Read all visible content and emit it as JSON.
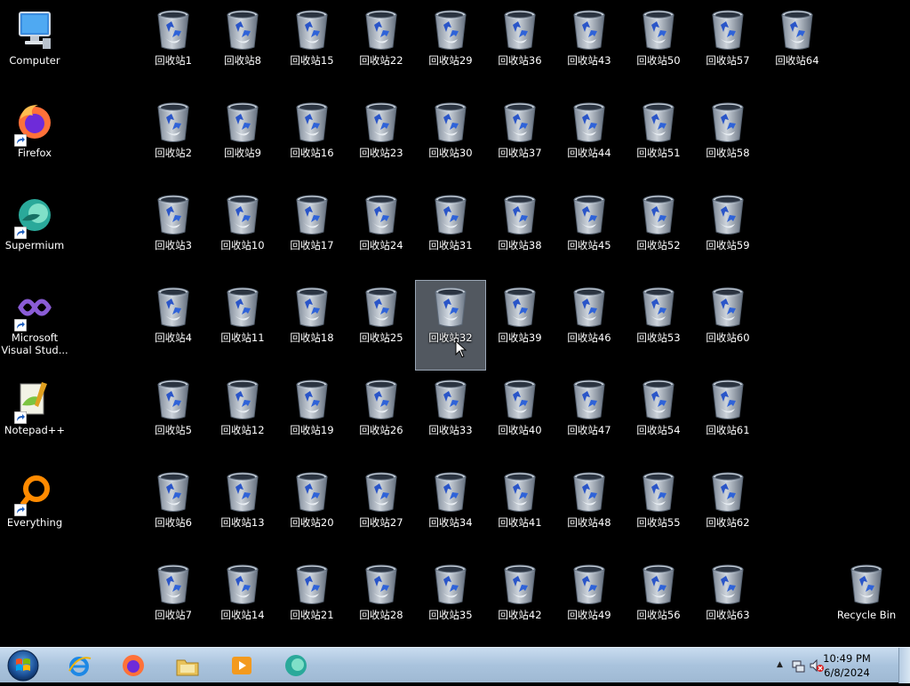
{
  "desktop": {
    "left_icons": [
      {
        "label": "Computer",
        "icon": "computer-icon"
      },
      {
        "label": "Firefox",
        "icon": "firefox-icon"
      },
      {
        "label": "Supermium",
        "icon": "supermium-icon"
      },
      {
        "label": "Microsoft Visual Stud...",
        "icon": "visual-studio-icon"
      },
      {
        "label": "Notepad++",
        "icon": "notepad-plus-plus-icon"
      },
      {
        "label": "Everything",
        "icon": "everything-icon"
      }
    ],
    "bin_labels": [
      [
        "回收站1",
        "回收站2",
        "回收站3",
        "回收站4",
        "回收站5",
        "回收站6",
        "回收站7"
      ],
      [
        "回收站8",
        "回收站9",
        "回收站10",
        "回收站11",
        "回收站12",
        "回收站13",
        "回收站14"
      ],
      [
        "回收站15",
        "回收站16",
        "回收站17",
        "回收站18",
        "回收站19",
        "回收站20",
        "回收站21"
      ],
      [
        "回收站22",
        "回收站23",
        "回收站24",
        "回收站25",
        "回收站26",
        "回收站27",
        "回收站28"
      ],
      [
        "回收站29",
        "回收站30",
        "回收站31",
        "回收站32",
        "回收站33",
        "回收站34",
        "回收站35"
      ],
      [
        "回收站36",
        "回收站37",
        "回收站38",
        "回收站39",
        "回收站40",
        "回收站41",
        "回收站42"
      ],
      [
        "回收站43",
        "回收站44",
        "回收站45",
        "回收站46",
        "回收站47",
        "回收站48",
        "回收站49"
      ],
      [
        "回收站50",
        "回收站51",
        "回收站52",
        "回收站53",
        "回收站54",
        "回收站55",
        "回收站56"
      ],
      [
        "回收站57",
        "回收站58",
        "回收站59",
        "回收站60",
        "回收站61",
        "回收站62",
        "回收站63"
      ],
      [
        "回收站64"
      ]
    ],
    "selected_label": "回收站32",
    "recycle_bin_label": "Recycle Bin"
  },
  "taskbar": {
    "pinned": [
      {
        "name": "internet-explorer-icon"
      },
      {
        "name": "firefox-icon"
      },
      {
        "name": "file-explorer-icon"
      },
      {
        "name": "media-player-icon"
      },
      {
        "name": "supermium-icon"
      }
    ],
    "clock": {
      "time": "10:49 PM",
      "date": "6/8/2024"
    }
  },
  "colors": {
    "desktop_bg": "#000000",
    "taskbar_top": "#c9dcef",
    "selection": "#96a0af"
  }
}
